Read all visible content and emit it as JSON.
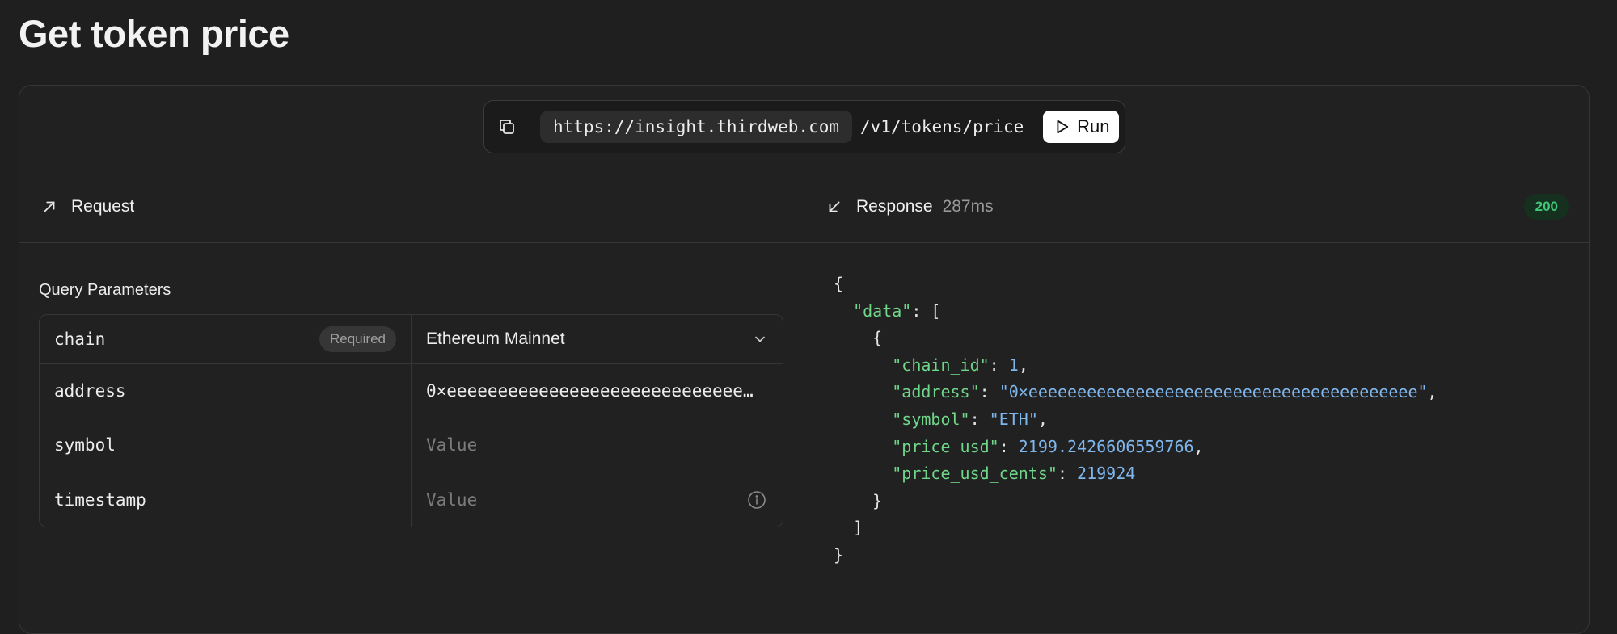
{
  "page": {
    "title": "Get token price"
  },
  "url_bar": {
    "base_url": "https://insight.thirdweb.com",
    "path": "/v1/tokens/price",
    "run_label": "Run"
  },
  "request": {
    "title": "Request",
    "section_label": "Query Parameters",
    "params": [
      {
        "name": "chain",
        "badge": "Required",
        "value": "Ethereum Mainnet",
        "placeholder": ""
      },
      {
        "name": "address",
        "badge": "",
        "value": "0×eeeeeeeeeeeeeeeeeeeeeeeeeeeeeeeeeeeeeeee",
        "placeholder": ""
      },
      {
        "name": "symbol",
        "badge": "",
        "value": "",
        "placeholder": "Value"
      },
      {
        "name": "timestamp",
        "badge": "",
        "value": "",
        "placeholder": "Value"
      }
    ]
  },
  "response": {
    "title": "Response",
    "latency": "287ms",
    "status": "200",
    "json": {
      "data_key": "\"data\"",
      "chain_id_key": "\"chain_id\"",
      "chain_id_val": "1",
      "address_key": "\"address\"",
      "address_val": "\"0×eeeeeeeeeeeeeeeeeeeeeeeeeeeeeeeeeeeeeeee\"",
      "symbol_key": "\"symbol\"",
      "symbol_val": "\"ETH\"",
      "price_usd_key": "\"price_usd\"",
      "price_usd_val": "2199.2426606559766",
      "price_usd_cents_key": "\"price_usd_cents\"",
      "price_usd_cents_val": "219924"
    }
  },
  "icons": [
    "copy-icon",
    "play-icon",
    "arrow-up-right-icon",
    "arrow-down-left-icon",
    "chevron-down-icon",
    "info-icon"
  ],
  "colors": {
    "background": "#1f1f1f",
    "json_key": "#6fd68a",
    "json_value": "#7fb6ec",
    "status_ok": "#3ec878"
  }
}
